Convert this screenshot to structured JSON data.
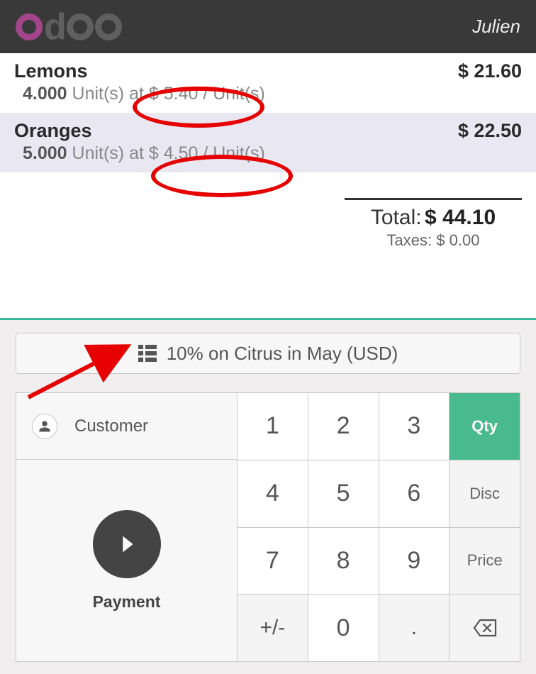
{
  "header": {
    "logo_text": "odoo",
    "username": "Julien"
  },
  "order": {
    "lines": [
      {
        "product": "Lemons",
        "qty": "4.000",
        "uom": "Unit(s)",
        "at": "at",
        "price": "$ 5.40",
        "per": "/ Unit(s)",
        "total": "$ 21.60",
        "selected": false
      },
      {
        "product": "Oranges",
        "qty": "5.000",
        "uom": "Unit(s)",
        "at": "at",
        "price": "$ 4.50",
        "per": "/ Unit(s)",
        "total": "$ 22.50",
        "selected": true
      }
    ],
    "total_label": "Total:",
    "total_amount": "$ 44.10",
    "taxes_label": "Taxes:",
    "taxes_amount": "$ 0.00"
  },
  "pricelist": {
    "label": "10% on Citrus in May (USD)"
  },
  "actions": {
    "customer": "Customer",
    "payment": "Payment"
  },
  "numpad": {
    "keys": [
      "1",
      "2",
      "3",
      "4",
      "5",
      "6",
      "7",
      "8",
      "9",
      "+/-",
      "0",
      "."
    ],
    "modes": {
      "qty": "Qty",
      "disc": "Disc",
      "price": "Price"
    },
    "backspace": "⌫"
  }
}
